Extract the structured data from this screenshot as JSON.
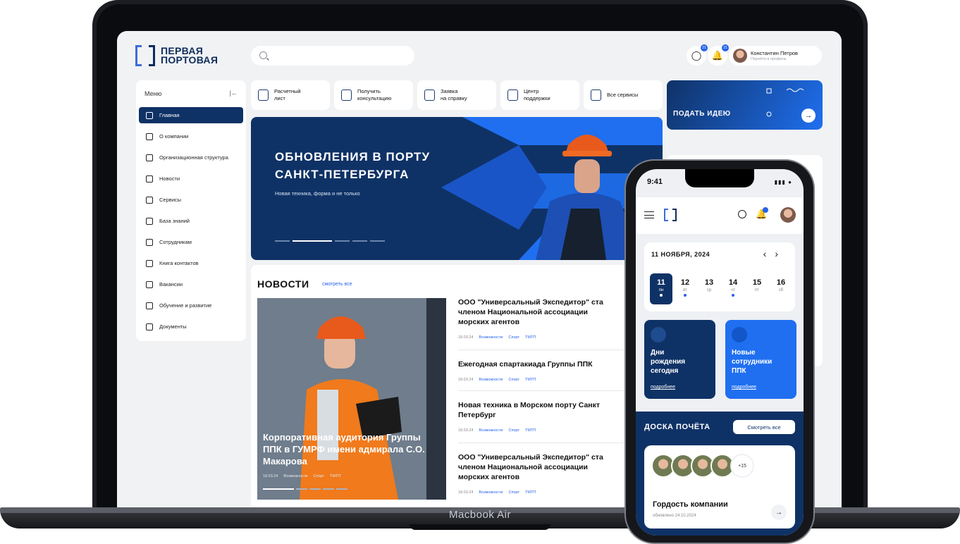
{
  "laptop": {
    "model_label": "Macbook Air"
  },
  "header": {
    "logo_line1": "ПЕРВАЯ",
    "logo_line2": "ПОРТОВАЯ",
    "search_placeholder": "",
    "chat_badge": "21",
    "bell_badge": "21",
    "user_name": "Константин Петров",
    "user_link": "Перейти в профиль"
  },
  "sidebar": {
    "title": "Меню",
    "items": [
      {
        "label": "Главная",
        "icon": "home-icon"
      },
      {
        "label": "О компании",
        "icon": "info-icon"
      },
      {
        "label": "Организационная структура",
        "icon": "structure-icon"
      },
      {
        "label": "Новости",
        "icon": "news-icon"
      },
      {
        "label": "Сервисы",
        "icon": "grid-icon"
      },
      {
        "label": "База знаний",
        "icon": "book-icon"
      },
      {
        "label": "Сотрудникам",
        "icon": "briefcase-icon"
      },
      {
        "label": "Книга контактов",
        "icon": "contacts-icon"
      },
      {
        "label": "Вакансии",
        "icon": "people-icon"
      },
      {
        "label": "Обучение и развитие",
        "icon": "star-icon"
      },
      {
        "label": "Документы",
        "icon": "document-icon"
      }
    ]
  },
  "tiles": [
    {
      "label": "Расчетный\nлист",
      "icon": "payslip-icon"
    },
    {
      "label": "Получить\nконсультацию",
      "icon": "user-heart-icon"
    },
    {
      "label": "Заявка\nна справку",
      "icon": "request-icon"
    },
    {
      "label": "Центр\nподдержки",
      "icon": "headset-icon"
    },
    {
      "label": "Все сервисы",
      "icon": "grid-icon"
    }
  ],
  "banner": {
    "title": "ОБНОВЛЕНИЯ В ПОРТУ САНКТ-ПЕТЕРБУРГА",
    "subtitle": "Новая техника, форма и не только"
  },
  "idea": {
    "label": "ПОДАТЬ ИДЕЮ"
  },
  "news": {
    "heading": "НОВОСТИ",
    "see_all": "смотреть все",
    "feature": {
      "caption": "Корпоративная аудитория Группы ППК в ГУМРФ имени адмирала С.О. Макарова",
      "date": "18.03.24",
      "tags": [
        "Возможности",
        "Спорт",
        "ТМТП"
      ]
    },
    "items": [
      {
        "title": "ООО \"Универсальный Экспедитор\" ста\nчленом Национальной ассоциации\nморских агентов",
        "date": "18.03.24",
        "tags": [
          "Возможности",
          "Спорт",
          "ТМТП"
        ]
      },
      {
        "title": "Ежегодная спартакиада Группы ППК",
        "date": "18.03.24",
        "tags": [
          "Возможности",
          "Спорт",
          "ТМТП"
        ]
      },
      {
        "title": "Новая техника в Морском порту Санкт\nПетербург",
        "date": "18.03.24",
        "tags": [
          "Возможности",
          "Спорт",
          "ТМТП"
        ]
      },
      {
        "title": "ООО \"Универсальный Экспедитор\" ста\nчленом Национальной ассоциации\nморских агентов",
        "date": "18.03.24",
        "tags": [
          "Возможности",
          "Спорт",
          "ТМТП"
        ]
      }
    ]
  },
  "phone": {
    "time": "9:41",
    "calendar": {
      "month": "11 НОЯБРЯ, 2024",
      "days": [
        {
          "num": "11",
          "wd": "пн",
          "dot": true
        },
        {
          "num": "12",
          "wd": "вт",
          "dot": true
        },
        {
          "num": "13",
          "wd": "ср",
          "dot": false
        },
        {
          "num": "14",
          "wd": "чт",
          "dot": true
        },
        {
          "num": "15",
          "wd": "пт",
          "dot": false
        },
        {
          "num": "16",
          "wd": "сб",
          "dot": false
        }
      ]
    },
    "cards": [
      {
        "title": "Дни\nрождения\nсегодня",
        "link": "подробнее",
        "color": "#0f3266"
      },
      {
        "title": "Новые\nсотрудники\nППК",
        "link": "подробнее",
        "color": "#1f6ff0"
      }
    ],
    "board": {
      "title": "ДОСКА ПОЧЁТА",
      "button": "Смотреть все",
      "more_count": "+15",
      "card_title": "Гордость компании",
      "card_date": "обновлено 24.10.2024"
    }
  }
}
